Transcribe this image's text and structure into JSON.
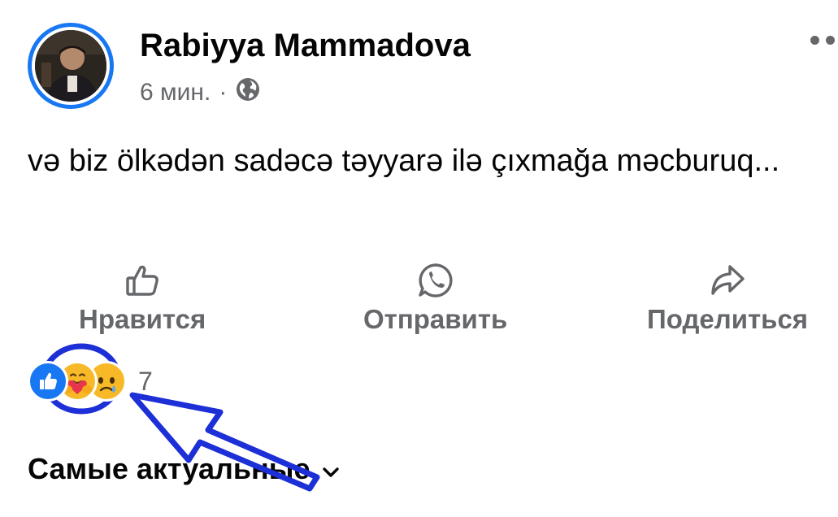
{
  "post": {
    "author": "Rabiyya Mammadova",
    "time": "6 мин.",
    "separator": "·",
    "text": "və biz ölkədən sadəcə təyyarə ilə çıxmağa məcburuq...",
    "privacy_icon": "globe-icon",
    "menu_icon": "more-dots-icon"
  },
  "actions": {
    "like_label": "Нравится",
    "send_label": "Отправить",
    "share_label": "Поделиться"
  },
  "reactions": {
    "types": [
      "like",
      "care",
      "sad"
    ],
    "count": "7"
  },
  "comments": {
    "sort_label": "Самые актуальные"
  },
  "colors": {
    "accent": "#1877f2",
    "secondary_text": "#65676b",
    "annotation": "#1d2fd6"
  }
}
